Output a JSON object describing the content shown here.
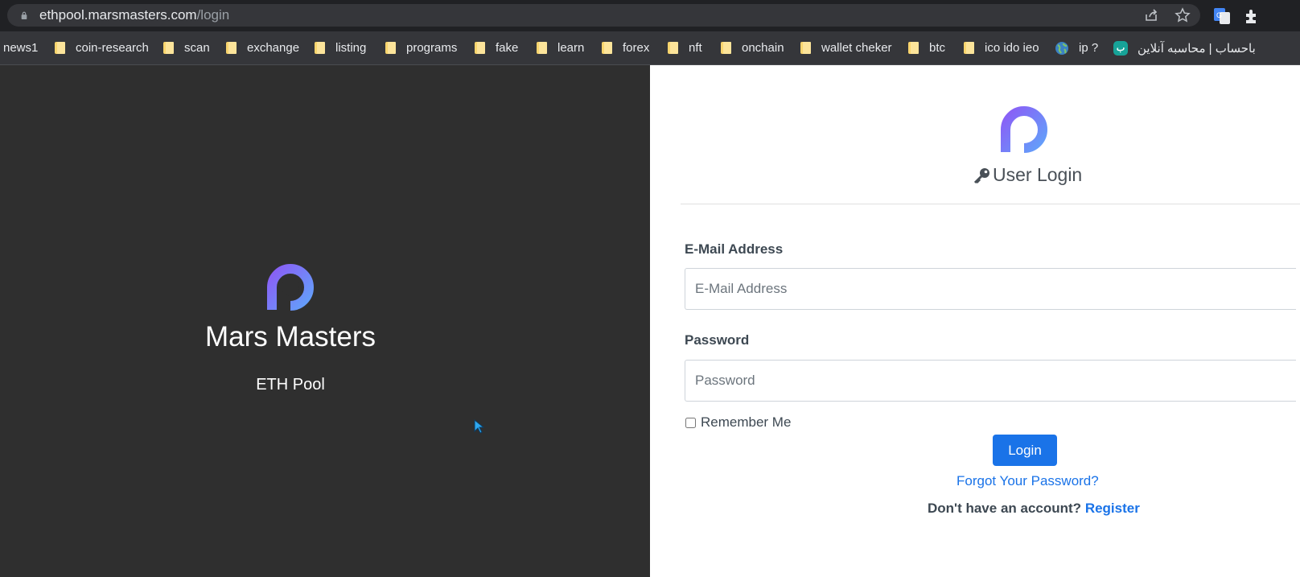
{
  "browser": {
    "url_host": "ethpool.marsmasters.com",
    "url_path": "/login"
  },
  "bookmarks": [
    {
      "label": "news1",
      "icon": "none"
    },
    {
      "label": "coin-research",
      "icon": "folder-icon"
    },
    {
      "label": "scan",
      "icon": "folder-icon"
    },
    {
      "label": "exchange",
      "icon": "folder-icon"
    },
    {
      "label": "listing",
      "icon": "folder-icon"
    },
    {
      "label": "programs",
      "icon": "folder-icon"
    },
    {
      "label": "fake",
      "icon": "folder-icon"
    },
    {
      "label": "learn",
      "icon": "folder-icon"
    },
    {
      "label": "forex",
      "icon": "folder-icon"
    },
    {
      "label": "nft",
      "icon": "folder-icon"
    },
    {
      "label": "onchain",
      "icon": "folder-icon"
    },
    {
      "label": "wallet cheker",
      "icon": "folder-icon"
    },
    {
      "label": "btc",
      "icon": "folder-icon"
    },
    {
      "label": "ico ido ieo",
      "icon": "folder-icon"
    },
    {
      "label": "ip ?",
      "icon": "globe-icon"
    },
    {
      "label": "باحساب | محاسبه آنلاین",
      "icon": "bale-icon"
    }
  ],
  "brand": {
    "title": "Mars Masters",
    "subtitle": "ETH Pool"
  },
  "login": {
    "title": "User Login",
    "email_label": "E-Mail Address",
    "email_placeholder": "E-Mail Address",
    "email_value": "",
    "password_label": "Password",
    "password_placeholder": "Password",
    "password_value": "",
    "remember_label": "Remember Me",
    "remember_checked": false,
    "submit_label": "Login",
    "forgot_label": "Forgot Your Password?",
    "no_account_text": "Don't have an account?",
    "register_label": "Register"
  },
  "colors": {
    "accent": "#1a73e8",
    "left_panel_bg": "#2f2f2f",
    "chrome_bg": "#202124"
  }
}
